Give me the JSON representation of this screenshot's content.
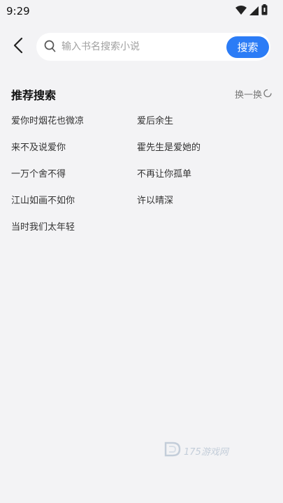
{
  "status_bar": {
    "time": "9:29",
    "icons": [
      "wifi-icon",
      "cellular-signal-icon",
      "battery-icon"
    ]
  },
  "header": {
    "back_icon": "chevron-left-icon",
    "search": {
      "placeholder": "输入书名搜索小说",
      "value": "",
      "icon": "search-icon"
    },
    "search_button_label": "搜索"
  },
  "recommended": {
    "title": "推荐搜索",
    "refresh_label": "换一换",
    "refresh_icon": "refresh-icon",
    "items": [
      "爱你时烟花也微凉",
      "爱后余生",
      "来不及说爱你",
      "霍先生是爱她的",
      "一万个舍不得",
      "不再让你孤单",
      "江山如画不如你",
      "许以晴深",
      "当时我们太年轻"
    ]
  },
  "watermark": {
    "text": "175游戏网"
  },
  "colors": {
    "background": "#f3f3f5",
    "accent": "#2b7cf6",
    "search_bg": "#ffffff"
  }
}
